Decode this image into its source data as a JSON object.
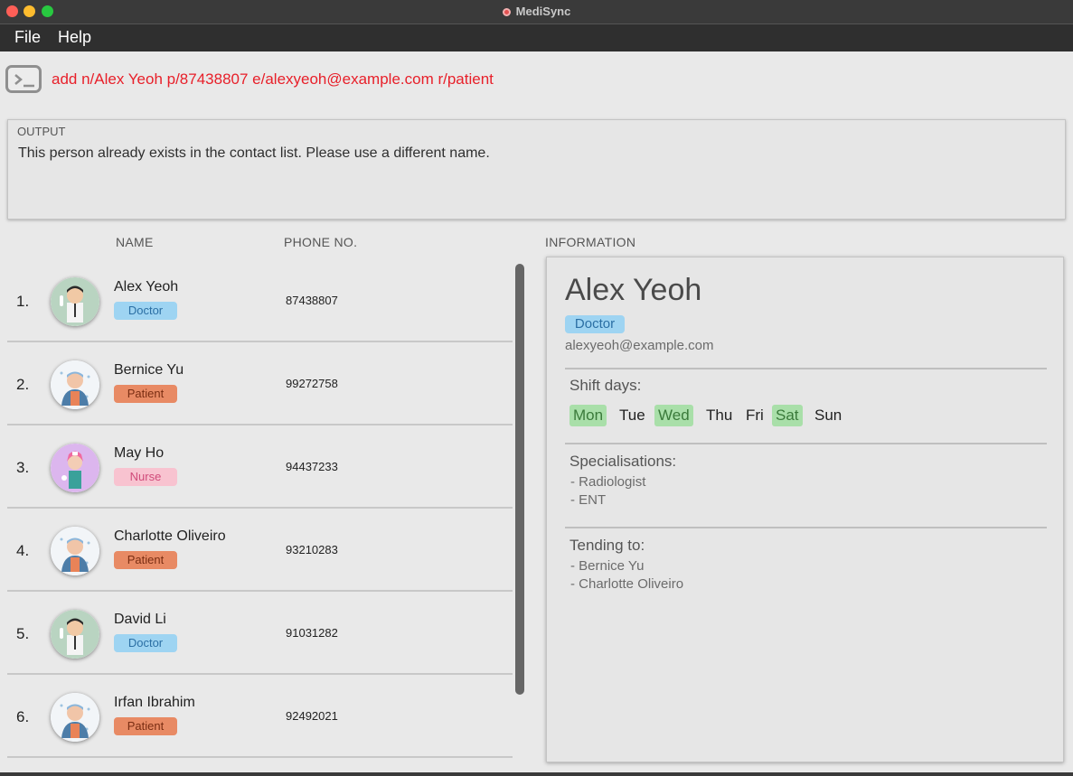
{
  "window": {
    "title": "MediSync"
  },
  "menu": {
    "file": "File",
    "help": "Help"
  },
  "command": {
    "icon": "terminal-icon",
    "text": "add n/Alex Yeoh p/87438807 e/alexyeoh@example.com r/patient",
    "text_color": "#e8202a"
  },
  "output": {
    "label": "OUTPUT",
    "message": "This person already exists in the contact list. Please use a different name."
  },
  "columns": {
    "name": "NAME",
    "phone": "PHONE NO.",
    "information": "INFORMATION"
  },
  "persons": [
    {
      "index": "1.",
      "name": "Alex Yeoh",
      "role": "Doctor",
      "phone": "87438807",
      "avatar": "doctor-avatar-icon"
    },
    {
      "index": "2.",
      "name": "Bernice Yu",
      "role": "Patient",
      "phone": "99272758",
      "avatar": "patient-avatar-icon"
    },
    {
      "index": "3.",
      "name": "May Ho",
      "role": "Nurse",
      "phone": "94437233",
      "avatar": "nurse-avatar-icon"
    },
    {
      "index": "4.",
      "name": "Charlotte Oliveiro",
      "role": "Patient",
      "phone": "93210283",
      "avatar": "patient-avatar-icon"
    },
    {
      "index": "5.",
      "name": "David Li",
      "role": "Doctor",
      "phone": "91031282",
      "avatar": "doctor-avatar-icon"
    },
    {
      "index": "6.",
      "name": "Irfan Ibrahim",
      "role": "Patient",
      "phone": "92492021",
      "avatar": "patient-avatar-icon"
    }
  ],
  "info": {
    "name": "Alex Yeoh",
    "role": "Doctor",
    "email": "alexyeoh@example.com",
    "shift_title": "Shift days:",
    "days": [
      {
        "label": "Mon",
        "active": true
      },
      {
        "label": "Tue",
        "active": false
      },
      {
        "label": "Wed",
        "active": true
      },
      {
        "label": "Thu",
        "active": false
      },
      {
        "label": "Fri",
        "active": false
      },
      {
        "label": "Sat",
        "active": true
      },
      {
        "label": "Sun",
        "active": false
      }
    ],
    "specialisations_title": "Specialisations:",
    "specialisations": [
      "- Radiologist",
      "- ENT"
    ],
    "tending_title": "Tending to:",
    "tending": [
      "- Bernice Yu",
      "- Charlotte Oliveiro"
    ]
  },
  "colors": {
    "doctor_tag": "#9ed4f2",
    "patient_tag": "#e88a64",
    "nurse_tag": "#f8c3d0",
    "active_day": "#a9dfa9"
  }
}
